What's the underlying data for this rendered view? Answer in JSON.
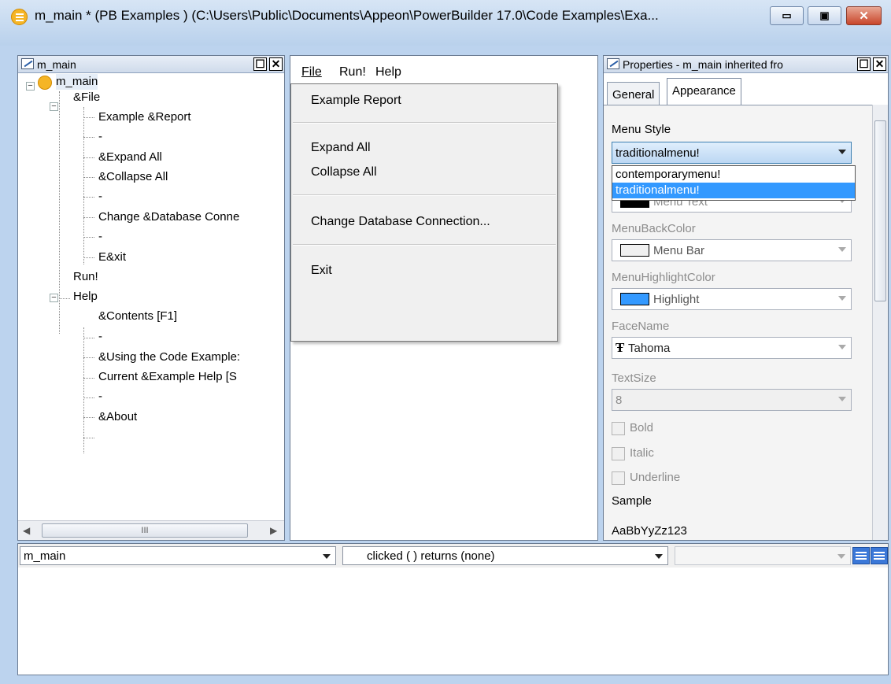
{
  "window": {
    "title": "m_main * (PB Examples ) (C:\\Users\\Public\\Documents\\Appeon\\PowerBuilder 17.0\\Code Examples\\Exa...",
    "minimize": "▭",
    "restore": "▣",
    "close": "✕"
  },
  "tree_pane": {
    "title": "m_main",
    "restore_btn": "☐",
    "close_btn": "✕",
    "root": "m_main",
    "items": [
      "&File",
      "Example &Report",
      "-",
      "&Expand All",
      "&Collapse All",
      "-",
      "Change &Database Conne",
      "-",
      "E&xit",
      "Run!",
      "Help",
      "&Contents  [F1]",
      "-",
      "&Using the Code Example:",
      "Current &Example Help  [S",
      "-",
      "&About"
    ],
    "scroll_left": "◀",
    "scroll_right": "▶",
    "scroll_grip": "III"
  },
  "preview_pane": {
    "menubar": [
      "File",
      "Run!",
      "Help"
    ],
    "dropdown": {
      "example_report": "Example Report",
      "expand_all": "Expand All",
      "collapse_all": "Collapse All",
      "change_db": "Change Database Connection...",
      "exit": "Exit"
    }
  },
  "properties_pane": {
    "title": "Properties - m_main  inherited  fro",
    "restore_btn": "☐",
    "close_btn": "✕",
    "tabs": [
      "General",
      "Appearance"
    ],
    "menu_style_label": "Menu Style",
    "menu_style_value": "traditionalmenu!",
    "menu_style_options": [
      "contemporarymenu!",
      "traditionalmenu!"
    ],
    "menu_text_partial": "Menu Text",
    "menu_back_color_label": "MenuBackColor",
    "menu_back_color_value": "Menu Bar",
    "menu_highlight_label": "MenuHighlightColor",
    "menu_highlight_value": "Highlight",
    "face_name_label": "FaceName",
    "face_name_value": "Tahoma",
    "font_glyph": "Ŧ",
    "text_size_label": "TextSize",
    "text_size_value": "8",
    "bold_label": "Bold",
    "italic_label": "Italic",
    "underline_label": "Underline",
    "sample_label": "Sample",
    "sample_text": "AaBbYyZz123",
    "colors": {
      "menu_text": "#000000",
      "menu_bar": "#f0f0f0",
      "highlight": "#3399ff"
    }
  },
  "script_pane": {
    "object_value": "m_main",
    "event_value": "clicked ( ) returns (none)",
    "third_value": ""
  }
}
